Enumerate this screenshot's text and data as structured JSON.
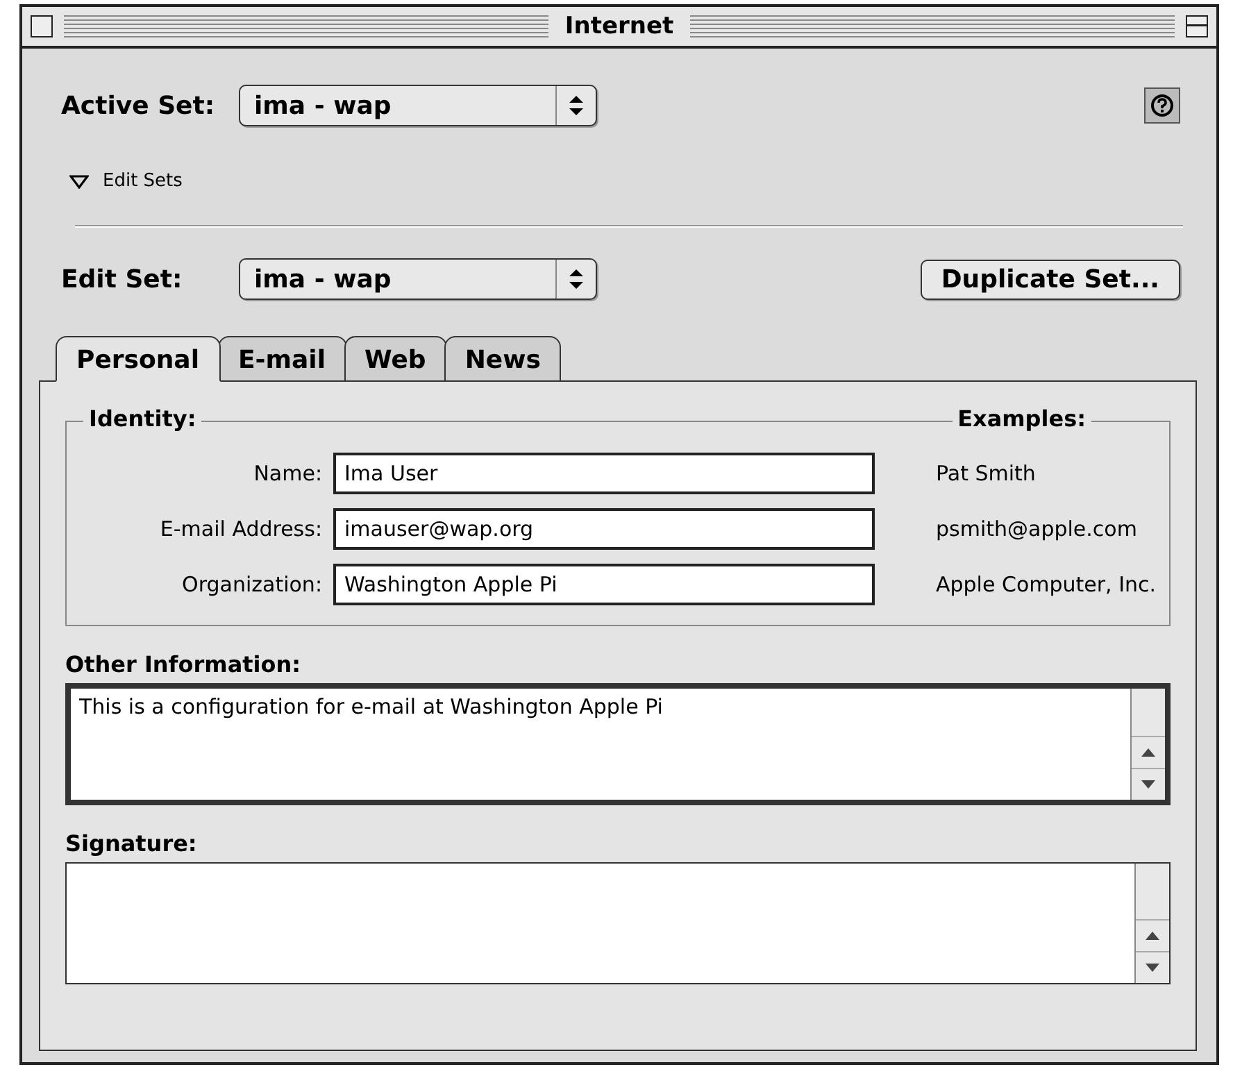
{
  "window": {
    "title": "Internet"
  },
  "active_set": {
    "label": "Active Set:",
    "value": "ima - wap"
  },
  "edit_sets_toggle": {
    "label": "Edit Sets",
    "expanded": true
  },
  "edit_set": {
    "label": "Edit Set:",
    "value": "ima - wap"
  },
  "duplicate_button": {
    "label": "Duplicate Set..."
  },
  "tabs": [
    {
      "label": "Personal",
      "selected": true
    },
    {
      "label": "E-mail",
      "selected": false
    },
    {
      "label": "Web",
      "selected": false
    },
    {
      "label": "News",
      "selected": false
    }
  ],
  "identity": {
    "title": "Identity:",
    "examples_title": "Examples:",
    "fields": [
      {
        "label": "Name:",
        "value": "Ima User",
        "example": "Pat Smith"
      },
      {
        "label": "E-mail Address:",
        "value": "imauser@wap.org",
        "example": "psmith@apple.com"
      },
      {
        "label": "Organization:",
        "value": "Washington Apple Pi",
        "example": "Apple Computer, Inc."
      }
    ]
  },
  "text_areas": [
    {
      "label": "Other Information:",
      "value": "This is a configuration for e-mail at Washington Apple Pi",
      "focused": true
    },
    {
      "label": "Signature:",
      "focused": false
    }
  ]
}
